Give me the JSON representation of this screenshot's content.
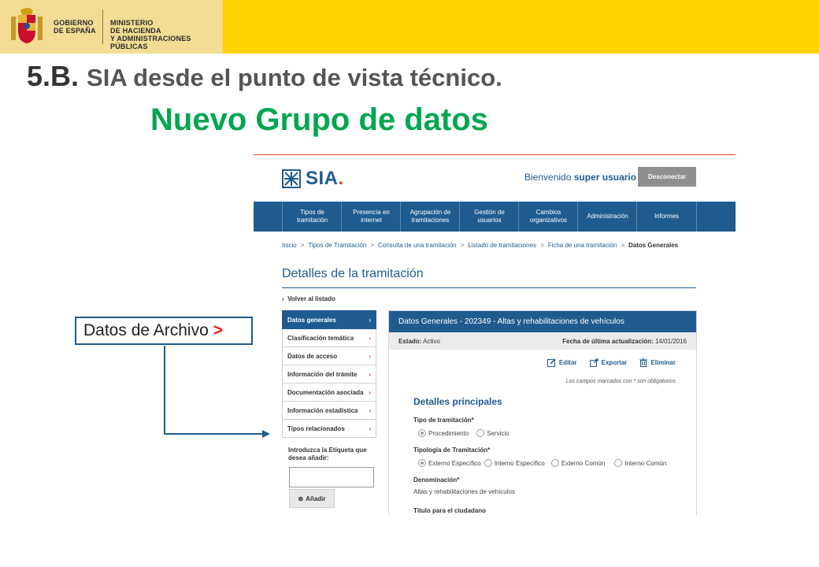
{
  "banner": {
    "gov_line1": "GOBIERNO",
    "gov_line2": "DE ESPAÑA",
    "min_line1": "MINISTERIO",
    "min_line2": "DE HACIENDA",
    "min_line3": "Y ADMINISTRACIONES PÚBLICAS"
  },
  "slide": {
    "title_number": "5.B.",
    "title_rest": "SIA desde el punto de vista técnico.",
    "subtitle": "Nuevo Grupo de datos"
  },
  "app": {
    "logo_text": "SIA",
    "logo_dot": ".",
    "welcome_prefix": "Bienvenido",
    "welcome_user": "super usuario",
    "logout_label": "Desconectar",
    "nav": [
      {
        "line1": "Tipos de",
        "line2": "tramitación"
      },
      {
        "line1": "Presencia en",
        "line2": "internet"
      },
      {
        "line1": "Agrupación de",
        "line2": "tramitaciones"
      },
      {
        "line1": "Gestión de",
        "line2": "usuarios"
      },
      {
        "line1": "Cambios",
        "line2": "organizativos"
      },
      {
        "line1": "Administración",
        "line2": ""
      },
      {
        "line1": "Informes",
        "line2": ""
      }
    ],
    "breadcrumb": [
      "Inicio",
      "Tipos de Tramitación",
      "Consulta de una tramitación",
      "Listado de tramitaciones",
      "Ficha de una tramitación",
      "Datos Generales"
    ],
    "breadcrumb_sep": ">",
    "page_heading": "Detalles de la tramitación",
    "back_label": "Volver al listado",
    "sidebar": [
      {
        "label": "Datos generales",
        "chev": "›"
      },
      {
        "label": "Clasificación temática",
        "chev": "›"
      },
      {
        "label": "Datos de acceso",
        "chev": "›"
      },
      {
        "label": "Información del trámite",
        "chev": "›"
      },
      {
        "label": "Documentación asociada",
        "chev": "›"
      },
      {
        "label": "Información estadística",
        "chev": "›"
      },
      {
        "label": "Tipos relacionados",
        "chev": "›"
      }
    ],
    "tag_label": "Introduzca la Etiqueta que desea añadir:",
    "tag_value": "",
    "add_label": "Añadir",
    "detail": {
      "header": "Datos Generales - 202349 - Altas y rehabilitaciones de vehículos",
      "status_label": "Estado:",
      "status_value": "Activo",
      "updated_label": "Fecha de última actualización:",
      "updated_value": "14/01/2016",
      "edit_label": "Editar",
      "export_label": "Exportar",
      "delete_label": "Eliminar",
      "required_note": "Los campos marcados con * son obligatorios",
      "section_title": "Detalles principales",
      "tipo_label": "Tipo de tramitación*",
      "tipo_options": [
        "Procedimiento",
        "Servicio"
      ],
      "tipologia_label": "Tipología de Tramitación*",
      "tipologia_options": [
        "Externo Específico",
        "Interno Específico",
        "Externo Común",
        "Interno Común"
      ],
      "denominacion_label": "Denominación*",
      "denominacion_value": "Altas y rehabilitaciones de vehículos",
      "titulo_label": "Título para el ciudadano"
    }
  },
  "callout": {
    "text": "Datos de Archivo",
    "marker": ">"
  },
  "colors": {
    "banner_yellow": "#ffd200",
    "sia_blue": "#1f5b8f",
    "subtitle_green": "#00a650",
    "accent_red": "#e2231a"
  }
}
